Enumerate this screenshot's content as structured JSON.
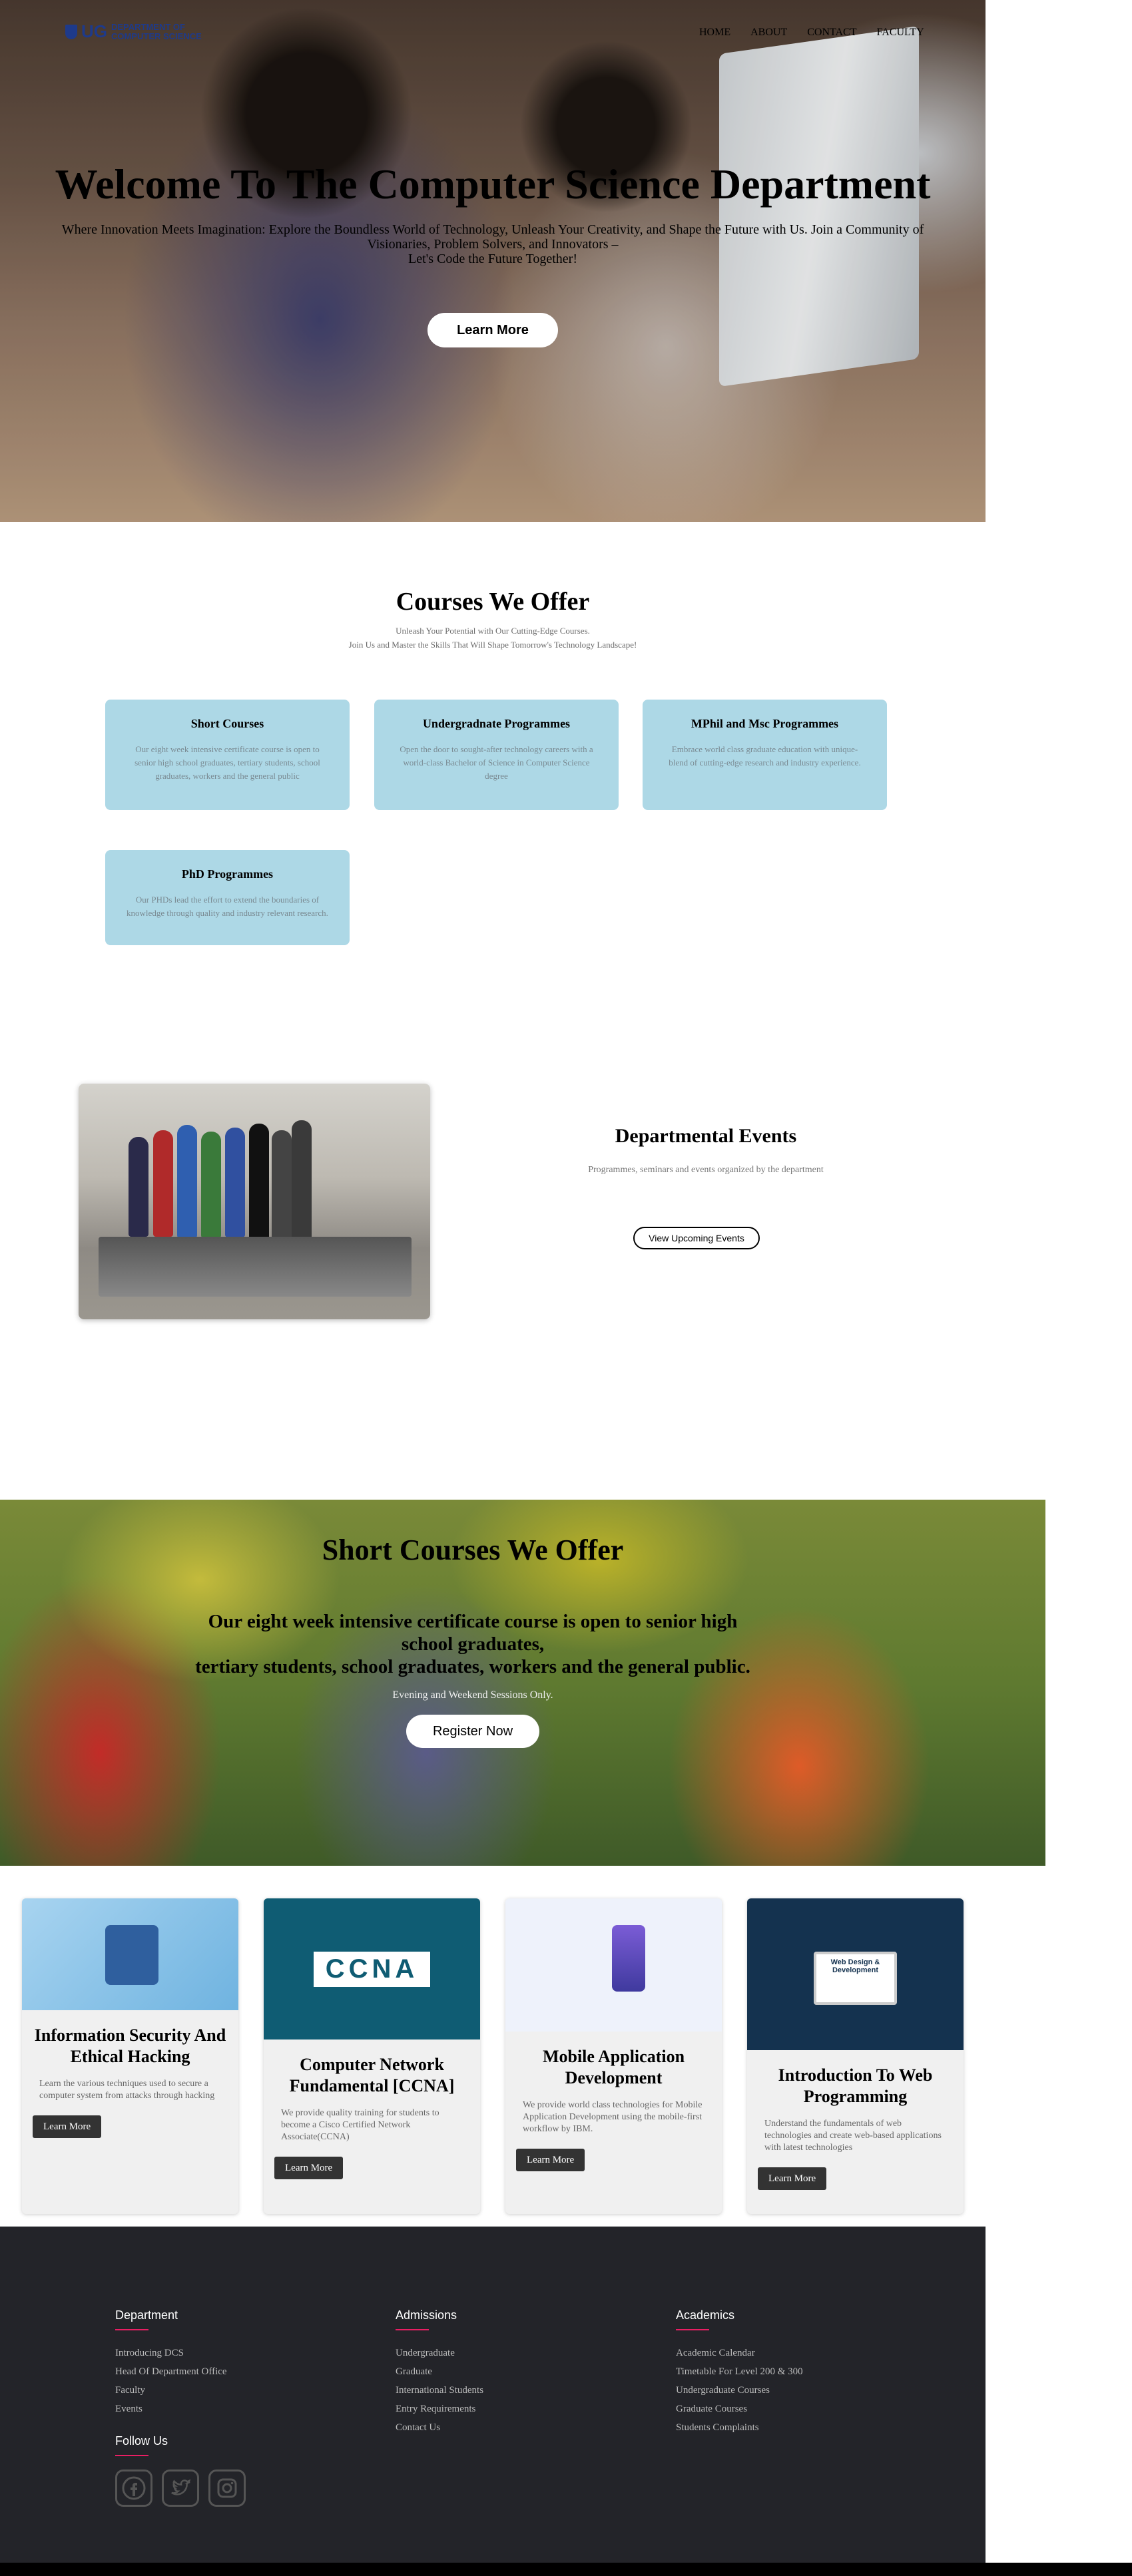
{
  "header": {
    "logo_text": "UG",
    "logo_dept_line1": "DEPARTMENT OF",
    "logo_dept_line2": "COMPUTER SCIENCE",
    "nav": [
      "HOME",
      "ABOUT",
      "CONTACT",
      "FACULTY"
    ]
  },
  "hero": {
    "title": "Welcome To The Computer Science Department",
    "subtitle_line1": "Where Innovation Meets Imagination: Explore the Boundless World of Technology, Unleash Your Creativity, and Shape the Future with Us. Join a Community of Visionaries, Problem Solvers, and Innovators –",
    "subtitle_line2": "Let's Code the Future Together!",
    "button": "Learn More"
  },
  "courses": {
    "title": "Courses We Offer",
    "sub_line1": "Unleash Your Potential with Our Cutting-Edge Courses.",
    "sub_line2": "Join Us and Master the Skills That Will Shape Tomorrow's Technology Landscape!",
    "items": [
      {
        "title": "Short Courses",
        "desc": "Our eight week intensive certificate course is open to senior high school graduates, tertiary students, school graduates, workers and the general public"
      },
      {
        "title": "Undergradnate Programmes",
        "desc": "Open the door to sought-after technology careers with a world-class Bachelor of Science in Computer Science degree"
      },
      {
        "title": "MPhil and Msc Programmes",
        "desc": "Embrace world class graduate education with unique-blend of cutting-edge research and industry experience."
      },
      {
        "title": "PhD Programmes",
        "desc": "Our PHDs lead the effort to extend the boundaries of knowledge through quality and industry relevant research."
      }
    ]
  },
  "events": {
    "title": "Departmental Events",
    "subtitle": "Programmes, seminars and events organized by the department",
    "button": "View Upcoming Events"
  },
  "short_courses": {
    "title": "Short Courses We Offer",
    "line1": "Our eight week intensive certificate course is open to senior high",
    "line2": "school graduates,",
    "line3": "tertiary students, school graduates, workers and the general public.",
    "note": "Evening and Weekend Sessions Only.",
    "button": "Register Now"
  },
  "course_cards": [
    {
      "title": "Information Security And Ethical Hacking",
      "desc": "Learn the various techniques used to secure a computer system from attacks through hacking",
      "button": "Learn More",
      "image_text": ""
    },
    {
      "title": "Computer Network Fundamental [CCNA]",
      "desc": "We provide quality training for students to become a Cisco Certified Network Associate(CCNA)",
      "button": "Learn More",
      "image_text": "CCNA"
    },
    {
      "title": "Mobile Application Development",
      "desc": "We provide world class technologies for Mobile Application Development using the mobile-first workflow by IBM.",
      "button": "Learn More",
      "image_text": ""
    },
    {
      "title": "Introduction To Web Programming",
      "desc": "Understand the fundamentals of web technologies and create web-based applications with latest technologies",
      "button": "Learn More",
      "image_text": "Web Design & Development"
    }
  ],
  "footer": {
    "department": {
      "heading": "Department",
      "links": [
        "Introducing DCS",
        "Head Of Department Office",
        "Faculty",
        "Events"
      ]
    },
    "admissions": {
      "heading": "Admissions",
      "links": [
        "Undergraduate",
        "Graduate",
        "International Students",
        "Entry Requirements",
        "Contact Us"
      ]
    },
    "academics": {
      "heading": "Academics",
      "links": [
        "Academic Calendar",
        "Timetable For Level 200 & 300",
        "Undergraduate Courses",
        "Graduate Courses",
        "Students Complaints"
      ]
    },
    "follow_heading": "Follow Us",
    "social_icons": [
      "facebook-icon",
      "twitter-icon",
      "instagram-icon"
    ]
  },
  "colors": {
    "card_bg": "#add8e6",
    "footer_bg": "#232429",
    "accent_underline": "#e91e63",
    "brand_blue": "#1e3a8a"
  }
}
